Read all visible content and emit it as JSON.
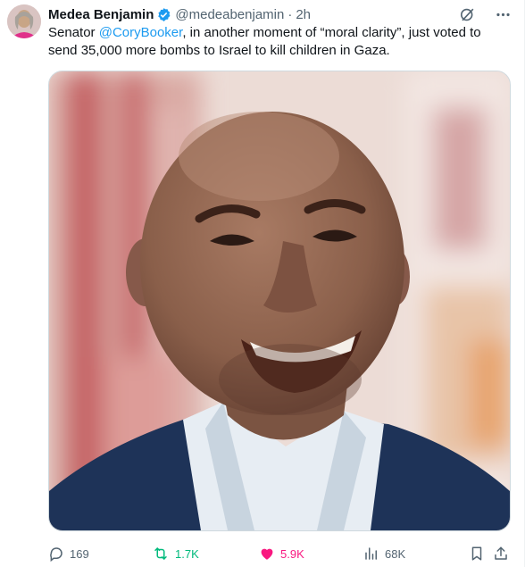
{
  "author": {
    "name": "Medea Benjamin",
    "handle": "@medeabenjamin",
    "separator": "·",
    "time": "2h",
    "verified_color": "#1d9bf0"
  },
  "tweet": {
    "text_before": "Senator ",
    "mention": "@CoryBooker",
    "text_after": ", in another moment of “moral clarity”, just voted to send 35,000 more bombs to Israel to kill children in Gaza."
  },
  "icons": {
    "grok": "grok-icon",
    "more": "more-icon",
    "reply": "reply-icon",
    "repost": "repost-icon",
    "like": "heart-icon",
    "views": "views-icon",
    "bookmark": "bookmark-icon",
    "share": "share-icon"
  },
  "actions": {
    "replies": "169",
    "reposts": "1.7K",
    "likes": "5.9K",
    "views": "68K"
  },
  "colors": {
    "accent": "#1d9bf0",
    "repost": "#00ba7c",
    "like": "#f91880",
    "secondary_text": "#536471"
  }
}
